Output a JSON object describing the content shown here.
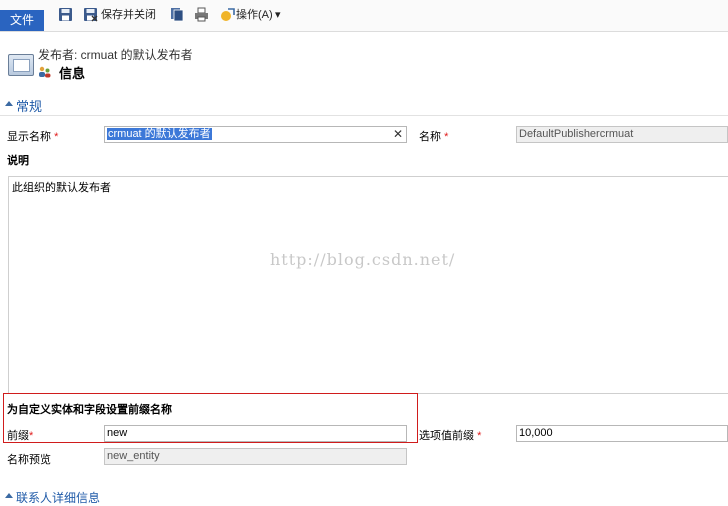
{
  "ribbon": {
    "file_label": "文件",
    "save_and_close_label": "保存并关闭",
    "actions_label": "操作(A)",
    "actions_arrow": "▾"
  },
  "header": {
    "subtitle": "发布者: crmuat 的默认发布者",
    "title": "信息"
  },
  "section": {
    "title": "常规"
  },
  "form": {
    "display_name_label": "显示名称",
    "display_name_value": "crmuat 的默认发布者",
    "name_label": "名称",
    "name_value": "DefaultPublishercrmuat",
    "description_label": "说明",
    "description_value": "此组织的默认发布者",
    "prefix_group_title": "为自定义实体和字段设置前缀名称",
    "prefix_label": "前缀",
    "prefix_value": "new",
    "option_prefix_label": "选项值前缀",
    "option_prefix_value": "10,000",
    "name_preview_label": "名称预览",
    "name_preview_value": "new_entity",
    "required_mark": "*",
    "clear_glyph": "✕"
  },
  "footer": {
    "next_section_title": "联系人详细信息"
  },
  "watermark": "http://blog.csdn.net/",
  "colors": {
    "accent": "#2a64c0",
    "section_title": "#1f5aa8",
    "required": "#e01b1b",
    "highlight_box": "#d01c1c"
  }
}
